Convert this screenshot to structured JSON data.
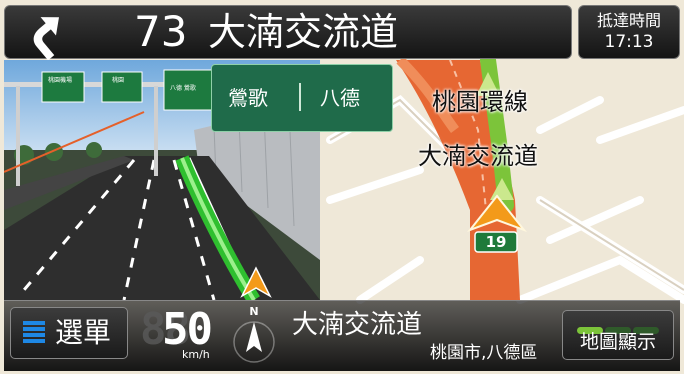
{
  "top_bar": {
    "turn_icon": "turn-left-arrow-icon",
    "distance": "73",
    "next_road": "大湳交流道"
  },
  "arrival": {
    "label": "抵達時間",
    "time": "17:13"
  },
  "direction_sign": {
    "left": "鶯歌",
    "right": "八德"
  },
  "map": {
    "labels": [
      "桃園環線",
      "大湳交流道"
    ],
    "route_shield": "19",
    "colors": {
      "route": "#e5602a",
      "lane_guidance": "#7cc43a",
      "background": "#efe8d8"
    }
  },
  "bottom_bar": {
    "menu_label": "選單",
    "menu_icon": "menu-icon",
    "speed": "50",
    "speed_ghost": "88",
    "speed_unit": "km/h",
    "compass_icon": "north-compass-icon",
    "compass_label": "N",
    "current_road": "大湳交流道",
    "current_area": "桃園市,八德區",
    "map_view_label": "地圖顯示",
    "gps_signal_bars": 1
  }
}
